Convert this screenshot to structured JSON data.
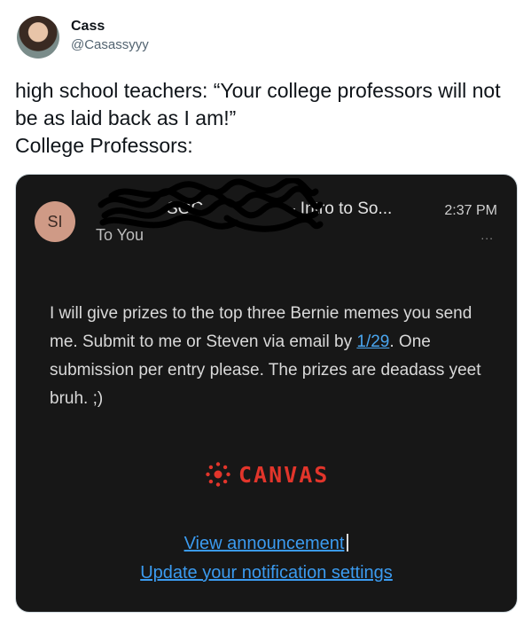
{
  "tweet": {
    "display_name": "Cass",
    "handle": "@Casassyyy",
    "text": "high school teachers: “Your college professors will not be as laid back as I am!”\nCollege Professors:"
  },
  "email": {
    "avatar_initials": "SI",
    "sender_partial": "SOC",
    "subject_preview": "- Intro to So...",
    "time": "2:37 PM",
    "to": "To You",
    "more": "...",
    "body_before_date": "I will give prizes to the top three Bernie memes you send me.  Submit to me or Steven via email by ",
    "date_link": "1/29",
    "body_after_date": ".  One submission per entry please.  The prizes are deadass yeet bruh.  ;)",
    "brand": "CANVAS",
    "view_announcement": "View announcement",
    "update_notifications": "Update your notification settings"
  },
  "colors": {
    "canvas_red": "#e2352b",
    "link_blue": "#3b9bf0",
    "email_bg": "#171717"
  }
}
